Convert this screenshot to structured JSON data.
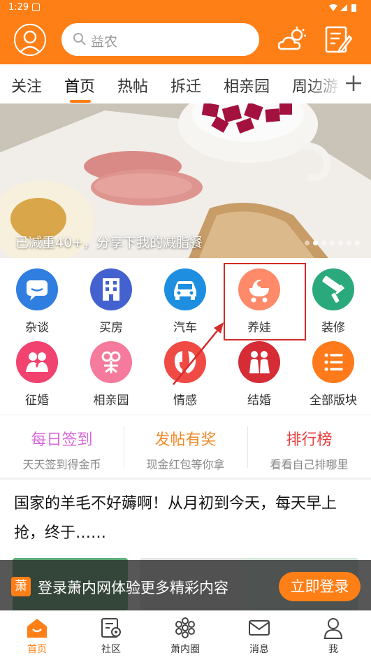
{
  "status_bar": {
    "time": "1:29"
  },
  "header": {
    "search_placeholder": "益农",
    "icons": [
      "user-avatar-icon",
      "weather-icon",
      "compose-icon"
    ]
  },
  "tabs": [
    {
      "label": "关注",
      "active": false
    },
    {
      "label": "首页",
      "active": true
    },
    {
      "label": "热帖",
      "active": false
    },
    {
      "label": "拆迁",
      "active": false
    },
    {
      "label": "相亲园",
      "active": false
    },
    {
      "label": "周边游",
      "active": false
    }
  ],
  "banner": {
    "caption": "已减重40+，分享下我的减脂餐",
    "dot_count": 7,
    "active_dot": 1
  },
  "categories": [
    {
      "label": "杂谈",
      "icon": "chat-icon",
      "color": "#2f7ee0"
    },
    {
      "label": "买房",
      "icon": "building-icon",
      "color": "#4361cf"
    },
    {
      "label": "汽车",
      "icon": "car-icon",
      "color": "#1e8fe0"
    },
    {
      "label": "养娃",
      "icon": "baby-stroller-icon",
      "color": "#ff8a6a"
    },
    {
      "label": "装修",
      "icon": "paint-roller-icon",
      "color": "#2aa97c"
    },
    {
      "label": "征婚",
      "icon": "couple-icon",
      "color": "#f2426f"
    },
    {
      "label": "相亲园",
      "icon": "matchmaking-icon",
      "color": "#f57a9b"
    },
    {
      "label": "情感",
      "icon": "emotion-icon",
      "color": "#f04a45"
    },
    {
      "label": "结婚",
      "icon": "wedding-icon",
      "color": "#d62c35"
    },
    {
      "label": "全部版块",
      "icon": "list-icon",
      "color": "#ff7a1a"
    }
  ],
  "features": [
    {
      "title": "每日签到",
      "subtitle": "天天签到得金币",
      "color": "#d867d8"
    },
    {
      "title": "发帖有奖",
      "subtitle": "现金红包等你拿",
      "color": "#f08a2a"
    },
    {
      "title": "排行榜",
      "subtitle": "看看自己排哪里",
      "color": "#e83d3d"
    }
  ],
  "post": {
    "title": "国家的羊毛不好薅啊！从月初到今天，每天早上抢，终于……"
  },
  "login_prompt": {
    "logo_char": "萧",
    "text": "登录萧内网体验更多精彩内容",
    "button": "立即登录"
  },
  "bottom_nav": [
    {
      "label": "首页",
      "icon": "home-icon",
      "active": true
    },
    {
      "label": "社区",
      "icon": "community-icon",
      "active": false
    },
    {
      "label": "萧内圈",
      "icon": "circle-icon",
      "active": false
    },
    {
      "label": "消息",
      "icon": "message-icon",
      "active": false
    },
    {
      "label": "我",
      "icon": "profile-icon",
      "active": false
    }
  ],
  "colors": {
    "brand": "#ff7f17",
    "highlight": "#d42b2b"
  }
}
